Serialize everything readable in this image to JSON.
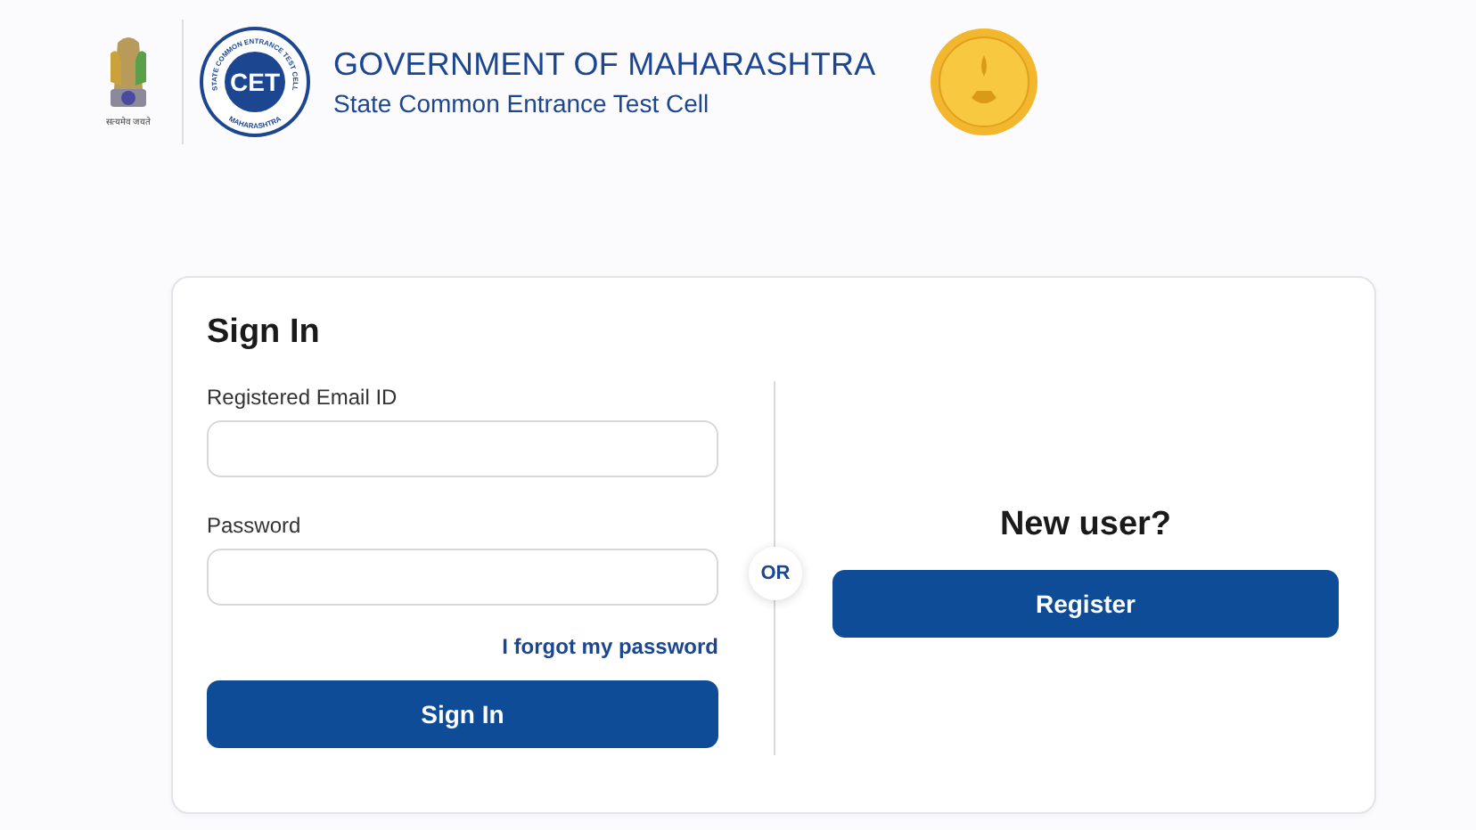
{
  "header": {
    "emblem_motto": "सत्यमेव जयते",
    "logo": {
      "ring_top": "STATE COMMON ENTRANCE TEST CELL",
      "ring_bottom": "MAHARASHTRA",
      "mark": "CET"
    },
    "title": "GOVERNMENT OF MAHARASHTRA",
    "subtitle": "State Common Entrance Test Cell"
  },
  "sign_in": {
    "heading": "Sign In",
    "fields": [
      {
        "label": "Registered Email ID"
      },
      {
        "label": "Password"
      }
    ],
    "forgot_link": "I forgot my password",
    "button": "Sign In"
  },
  "separator": "OR",
  "new_user": {
    "heading": "New user?",
    "button": "Register"
  }
}
